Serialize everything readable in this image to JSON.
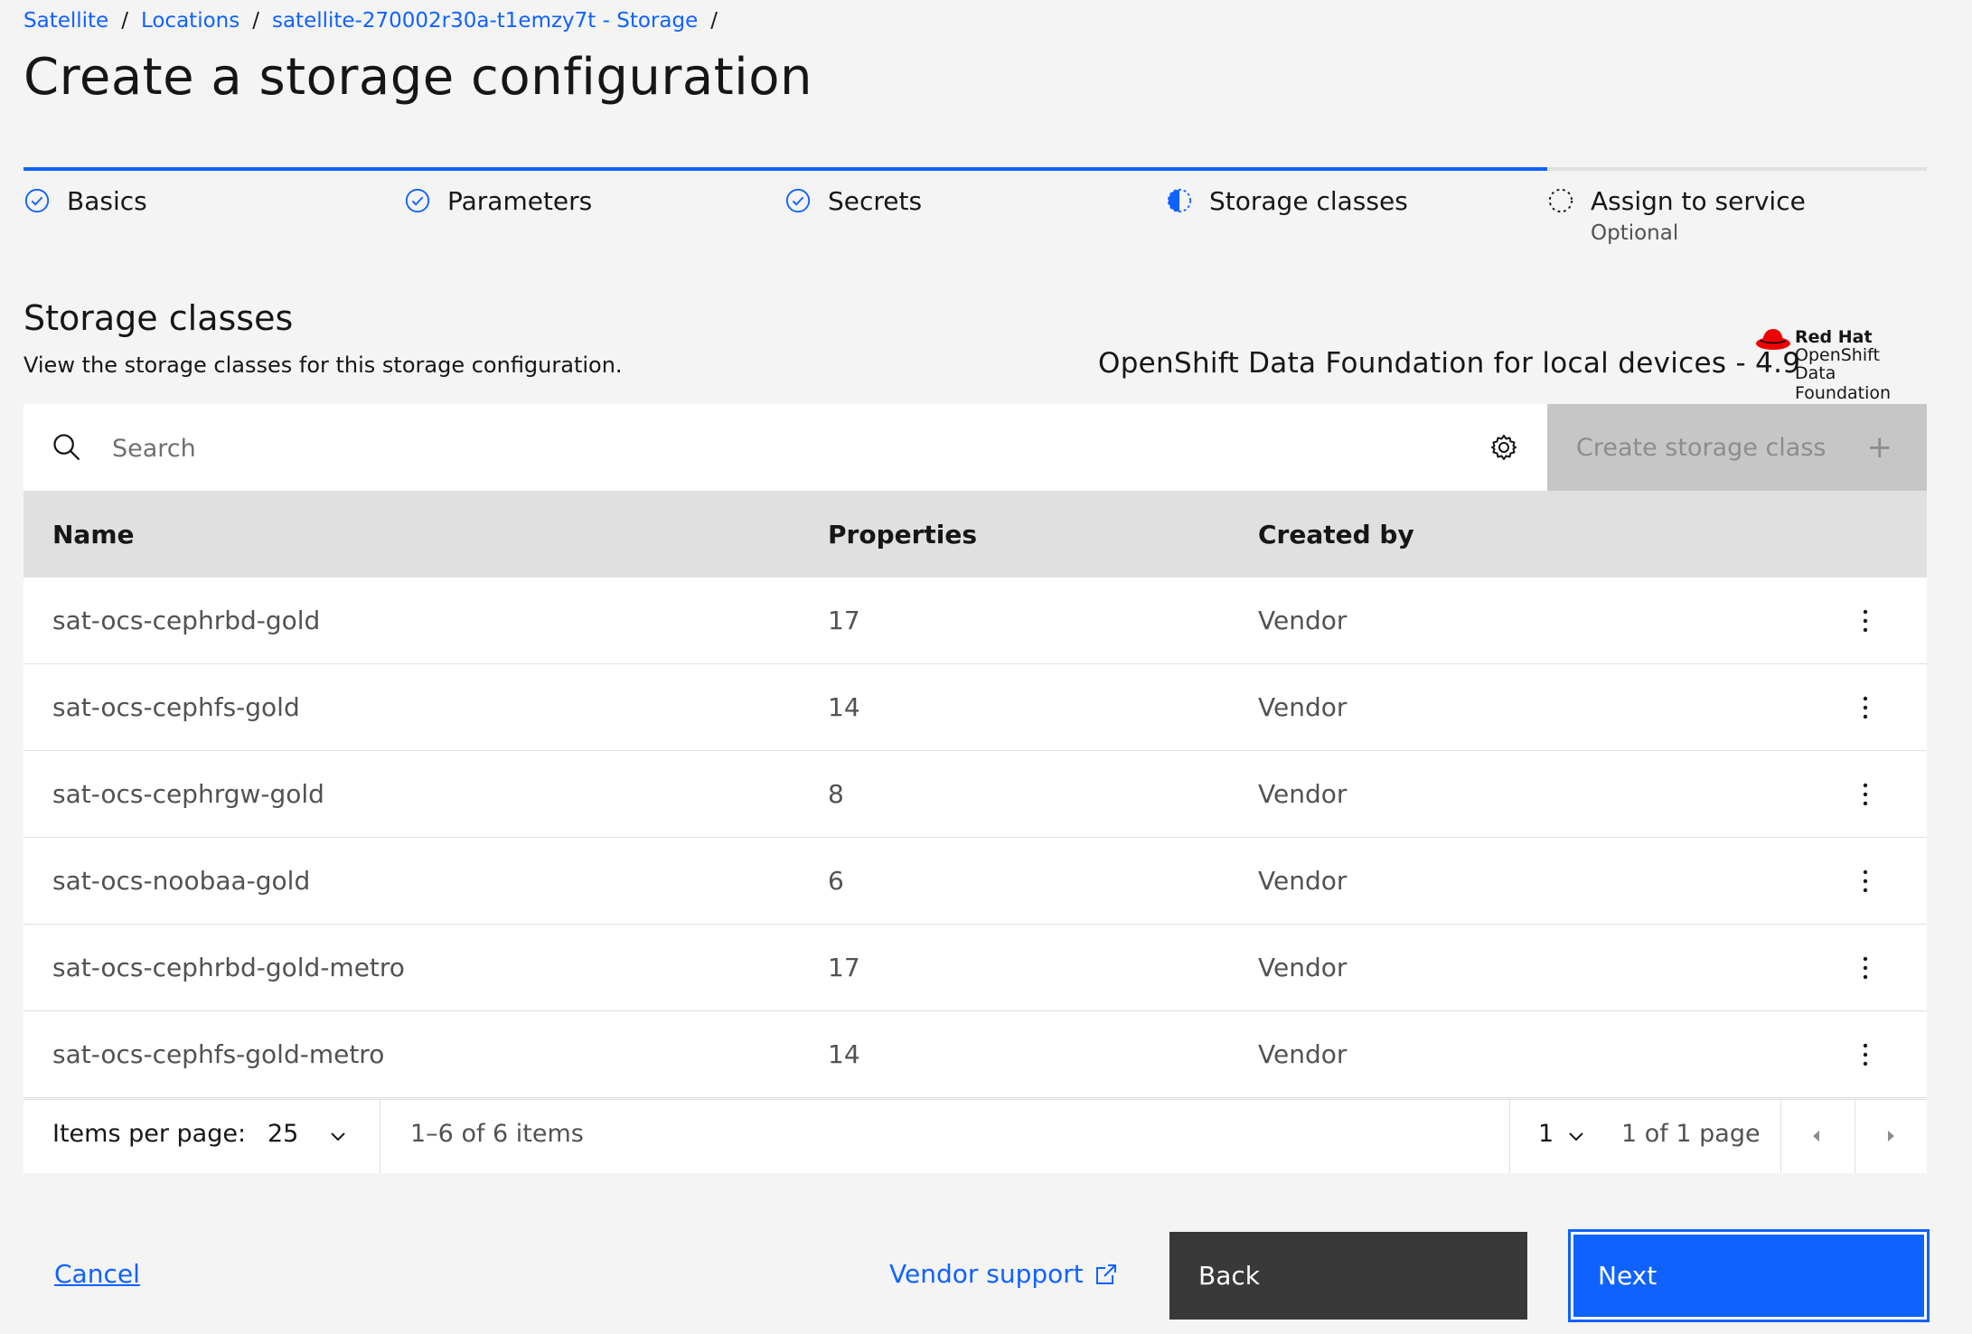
{
  "breadcrumb": [
    {
      "label": "Satellite"
    },
    {
      "label": "Locations"
    },
    {
      "label": "satellite-270002r30a-t1emzy7t - Storage"
    }
  ],
  "page_title": "Create a storage configuration",
  "progress": {
    "steps": [
      {
        "label": "Basics",
        "state": "complete"
      },
      {
        "label": "Parameters",
        "state": "complete"
      },
      {
        "label": "Secrets",
        "state": "complete"
      },
      {
        "label": "Storage classes",
        "state": "current"
      },
      {
        "label": "Assign to service",
        "sub": "Optional",
        "state": "incomplete"
      }
    ],
    "accent": "#0f62fe"
  },
  "section": {
    "title": "Storage classes",
    "description": "View the storage classes for this storage configuration.",
    "vendor_name": "OpenShift Data Foundation for local devices - 4.9",
    "logo": {
      "line1": "Red Hat",
      "line2": "OpenShift",
      "line3": "Data Foundation"
    }
  },
  "toolbar": {
    "search_placeholder": "Search",
    "create_label": "Create storage class",
    "create_icon": "+"
  },
  "table": {
    "headers": [
      "Name",
      "Properties",
      "Created by"
    ],
    "rows": [
      {
        "name": "sat-ocs-cephrbd-gold",
        "properties": "17",
        "created_by": "Vendor"
      },
      {
        "name": "sat-ocs-cephfs-gold",
        "properties": "14",
        "created_by": "Vendor"
      },
      {
        "name": "sat-ocs-cephrgw-gold",
        "properties": "8",
        "created_by": "Vendor"
      },
      {
        "name": "sat-ocs-noobaa-gold",
        "properties": "6",
        "created_by": "Vendor"
      },
      {
        "name": "sat-ocs-cephrbd-gold-metro",
        "properties": "17",
        "created_by": "Vendor"
      },
      {
        "name": "sat-ocs-cephfs-gold-metro",
        "properties": "14",
        "created_by": "Vendor"
      }
    ]
  },
  "pagination": {
    "items_per_page_label": "Items per page:",
    "items_per_page": "25",
    "range": "1–6 of 6 items",
    "page": "1",
    "page_of": "1 of 1 page"
  },
  "footer": {
    "cancel": "Cancel",
    "vendor_support": "Vendor support",
    "back": "Back",
    "next": "Next"
  }
}
